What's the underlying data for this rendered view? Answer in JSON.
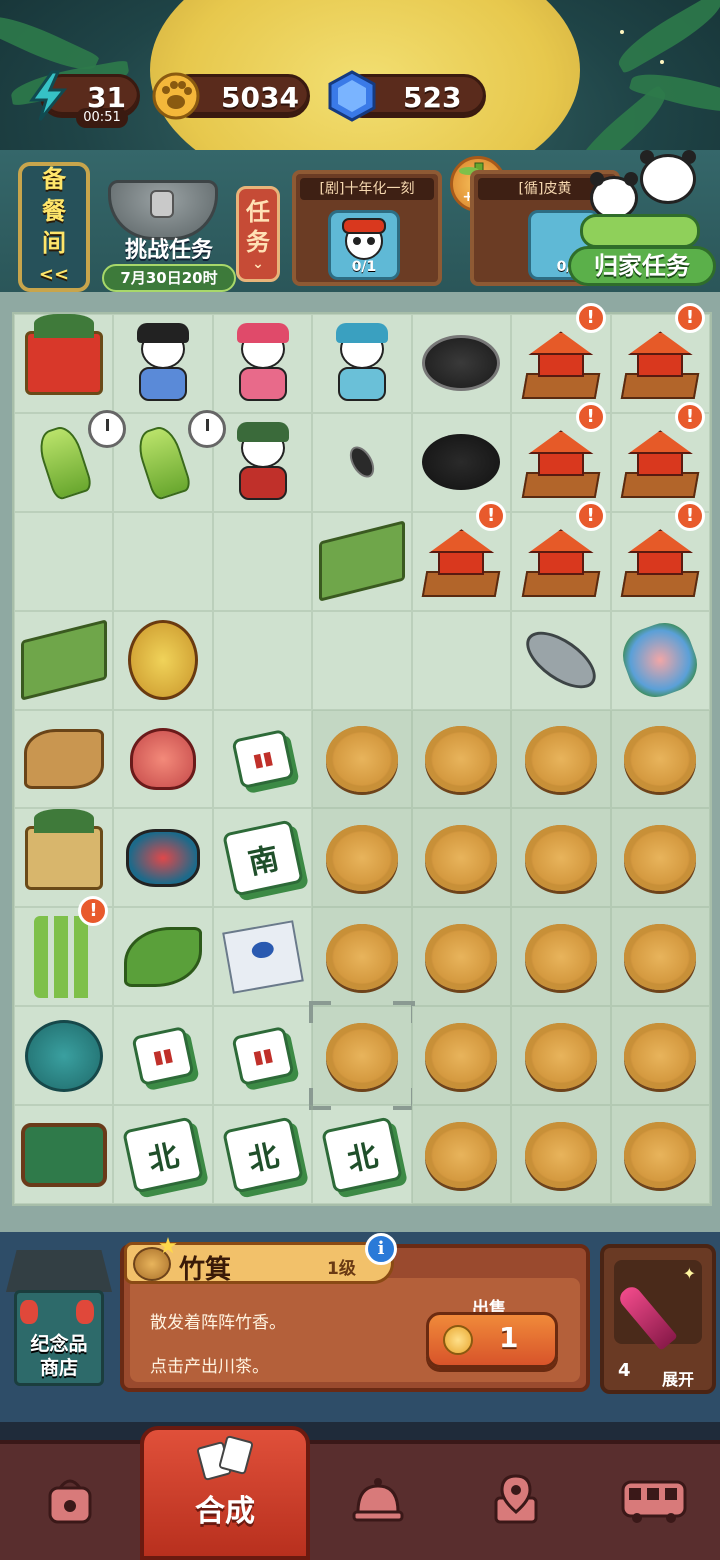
{
  "resources": {
    "energy": "31",
    "energy_timer": "00:51",
    "coins": "5034",
    "gems": "523"
  },
  "task_strip": {
    "pantry_label_lines": [
      "备",
      "餐",
      "间",
      "<<"
    ],
    "challenge": {
      "title": "挑战任务",
      "deadline": "7月30日20时"
    },
    "task_tab_lines": [
      "任",
      "务"
    ],
    "orders": [
      {
        "title": "[剧]十年化一刻",
        "progress": "0/1"
      },
      {
        "title": "[循]皮黄",
        "progress": "0/"
      }
    ],
    "bamboo_reward": "+10",
    "home_task_label": "归家任务"
  },
  "board": {
    "rows": [
      [
        "mahjong-box",
        "panda-waiter",
        "panda-opera-red",
        "panda-opera-fan",
        "sunflower-seed-plate",
        "pagoda-shrine",
        "pagoda-shrine"
      ],
      [
        "bamboo-shoot",
        "bamboo-shoot",
        "panda-opera-general",
        "sunflower-seed",
        "sunflower-seeds",
        "pagoda-shrine",
        "pagoda-shrine"
      ],
      [
        "",
        "",
        "",
        "bamboo-garden",
        "pagoda-shrine",
        "pagoda-shrine",
        "pagoda-shrine"
      ],
      [
        "bamboo-garden",
        "monkey-mask",
        "",
        "",
        "",
        "metal-boat",
        "flower-bouquet"
      ],
      [
        "tea-tray",
        "purse",
        "mahjong-tiles",
        "basket",
        "basket",
        "basket",
        "basket"
      ],
      [
        "tea-box",
        "opera-headdress",
        "mahjong-south",
        "basket",
        "basket",
        "basket",
        "basket"
      ],
      [
        "bamboo-stalks",
        "tea-leaves",
        "bird-painting",
        "basket",
        "basket",
        "basket",
        "basket"
      ],
      [
        "sewing-kit",
        "mahjong-circle",
        "mahjong-bamboo",
        "basket",
        "basket",
        "basket",
        "basket"
      ],
      [
        "mahjong-table",
        "mahjong-north",
        "mahjong-north",
        "mahjong-north",
        "basket",
        "basket",
        "basket"
      ]
    ],
    "tile_glyphs": {
      "south": "南",
      "north": "北"
    }
  },
  "info_panel": {
    "shop_label_lines": [
      "纪念品",
      "商店"
    ],
    "item_name": "竹箕",
    "item_level": "1级",
    "info_icon": "i",
    "description": "散发着阵阵竹香。",
    "hint": "点击产出川茶。",
    "sell_label": "出售",
    "sell_price": "1",
    "inventory_count": "4",
    "inventory_expand": "展开"
  },
  "nav": {
    "active_label": "合成",
    "items": [
      "bag-icon",
      "merge-cards-icon",
      "service-bell-icon",
      "map-icon",
      "bus-icon"
    ]
  },
  "colors": {
    "board_bg": "#cfe1cf",
    "accent_red": "#d9381e",
    "button_orange": "#f08a3a",
    "nav_bg": "#592e2e"
  }
}
